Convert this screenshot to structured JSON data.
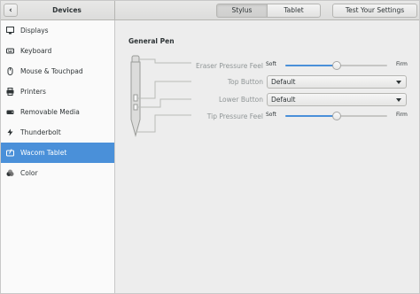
{
  "header": {
    "title": "Devices",
    "tabs": [
      {
        "label": "Stylus",
        "selected": true
      },
      {
        "label": "Tablet",
        "selected": false
      }
    ],
    "test_button": "Test Your Settings"
  },
  "sidebar": {
    "items": [
      {
        "label": "Displays",
        "icon": "display-icon"
      },
      {
        "label": "Keyboard",
        "icon": "keyboard-icon"
      },
      {
        "label": "Mouse & Touchpad",
        "icon": "mouse-icon"
      },
      {
        "label": "Printers",
        "icon": "printer-icon"
      },
      {
        "label": "Removable Media",
        "icon": "media-icon"
      },
      {
        "label": "Thunderbolt",
        "icon": "thunderbolt-icon"
      },
      {
        "label": "Wacom Tablet",
        "icon": "tablet-icon",
        "active": true
      },
      {
        "label": "Color",
        "icon": "color-icon"
      }
    ]
  },
  "main": {
    "section_title": "General Pen",
    "eraser": {
      "label": "Eraser Pressure Feel",
      "min_label": "Soft",
      "max_label": "Firm",
      "value": 0.5
    },
    "top_button": {
      "label": "Top Button",
      "value": "Default"
    },
    "lower_button": {
      "label": "Lower Button",
      "value": "Default"
    },
    "tip": {
      "label": "Tip Pressure Feel",
      "min_label": "Soft",
      "max_label": "Firm",
      "value": 0.5
    }
  },
  "colors": {
    "accent": "#4a90d9",
    "sidebar_bg": "#fafafa",
    "content_bg": "#ededed"
  }
}
